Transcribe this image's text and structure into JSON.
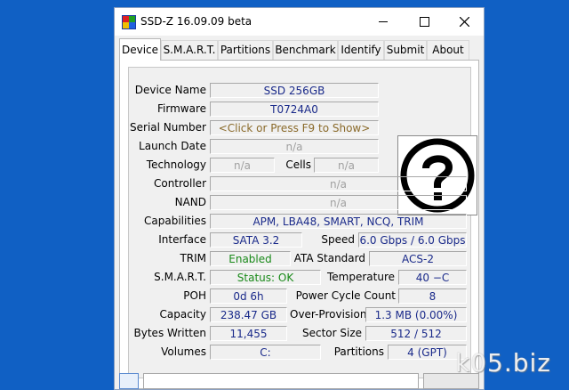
{
  "window": {
    "title": "SSD-Z 16.09.09 beta"
  },
  "tabs": [
    {
      "label": "Device"
    },
    {
      "label": "S.M.A.R.T."
    },
    {
      "label": "Partitions"
    },
    {
      "label": "Benchmark"
    },
    {
      "label": "Identify"
    },
    {
      "label": "Submit"
    },
    {
      "label": "About"
    }
  ],
  "device": {
    "device_name": {
      "label": "Device Name",
      "value": "SSD 256GB"
    },
    "firmware": {
      "label": "Firmware",
      "value": "T0724A0"
    },
    "serial_number": {
      "label": "Serial Number",
      "value": "<Click or Press F9 to Show>"
    },
    "launch_date": {
      "label": "Launch Date",
      "value": "n/a"
    },
    "technology": {
      "label": "Technology",
      "value": "n/a"
    },
    "cells": {
      "label": "Cells",
      "value": "n/a"
    },
    "controller": {
      "label": "Controller",
      "value": "n/a"
    },
    "nand": {
      "label": "NAND",
      "value": "n/a"
    },
    "capabilities": {
      "label": "Capabilities",
      "value": "APM, LBA48, SMART, NCQ, TRIM"
    },
    "interface": {
      "label": "Interface",
      "value": "SATA 3.2"
    },
    "speed": {
      "label": "Speed",
      "value": "6.0 Gbps / 6.0 Gbps"
    },
    "trim": {
      "label": "TRIM",
      "value": "Enabled"
    },
    "ata_standard": {
      "label": "ATA Standard",
      "value": "ACS-2"
    },
    "smart": {
      "label": "S.M.A.R.T.",
      "value": "Status: OK"
    },
    "temperature": {
      "label": "Temperature",
      "value": "40 −C"
    },
    "poh": {
      "label": "POH",
      "value": "0d 6h"
    },
    "power_cycle_count": {
      "label": "Power Cycle Count",
      "value": "8"
    },
    "capacity": {
      "label": "Capacity",
      "value": "238.47 GB"
    },
    "over_provision": {
      "label": "Over-Provision",
      "value": "1.3 MB (0.00%)"
    },
    "bytes_written": {
      "label": "Bytes Written",
      "value": "11,455"
    },
    "sector_size": {
      "label": "Sector Size",
      "value": "512 / 512"
    },
    "volumes": {
      "label": "Volumes",
      "value": "C:"
    },
    "partitions": {
      "label": "Partitions",
      "value": "4 (GPT)"
    }
  },
  "image_icon": "question-mark-icon",
  "watermark": "k05.biz",
  "colors": {
    "desktop": "#1060c4",
    "value_text": "#1a2a8a",
    "enabled_green": "#1a8a1a",
    "link_brown": "#8a6a2a"
  }
}
